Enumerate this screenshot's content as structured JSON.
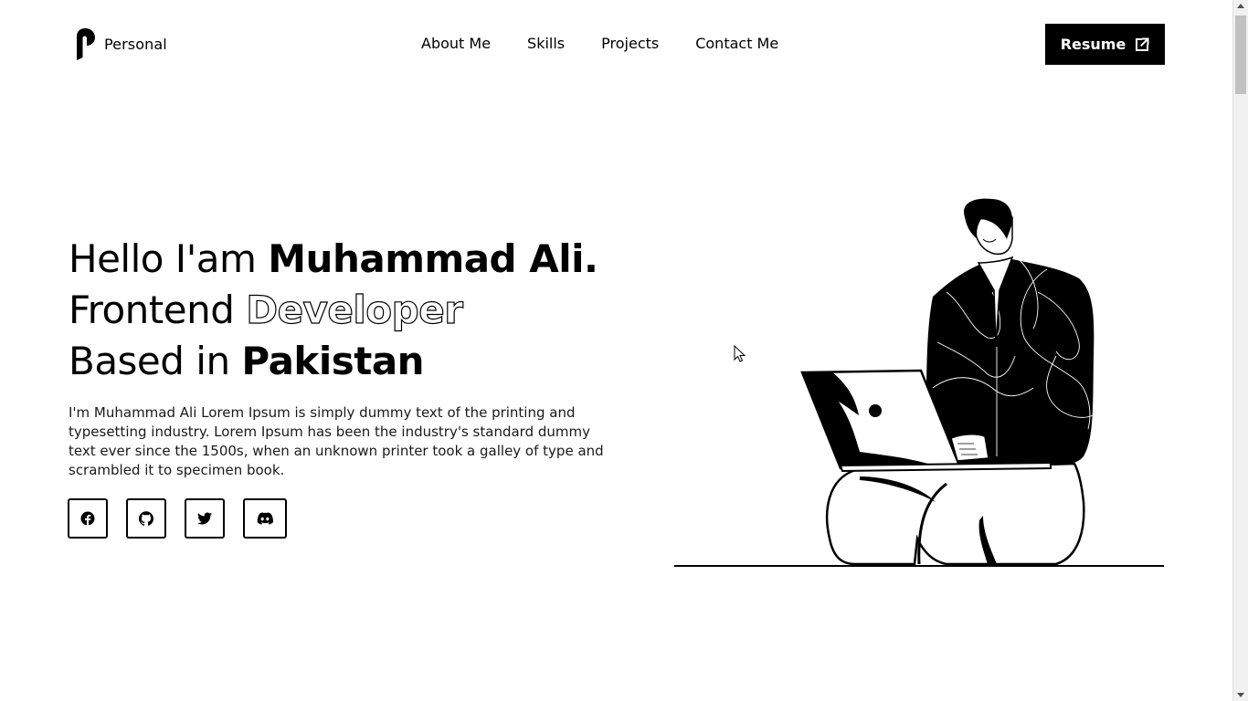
{
  "header": {
    "logo_text": "Personal",
    "nav": [
      {
        "label": "About Me"
      },
      {
        "label": "Skills"
      },
      {
        "label": "Projects"
      },
      {
        "label": "Contact Me"
      }
    ],
    "resume_label": "Resume",
    "resume_icon": "external-link-icon"
  },
  "hero": {
    "line1_prefix": "Hello I'am ",
    "line1_name": "Muhammad Ali.",
    "line2_prefix": "Frontend ",
    "line2_outlined": "Developer",
    "line3_prefix": "Based in ",
    "line3_place": "Pakistan",
    "description": "I'm Muhammad Ali Lorem Ipsum is simply dummy text of the printing and typesetting industry. Lorem Ipsum has been the industry's standard dummy text ever since the 1500s, when an unknown printer took a galley of type and scrambled it to specimen book."
  },
  "socials": [
    {
      "icon": "facebook-icon"
    },
    {
      "icon": "github-icon"
    },
    {
      "icon": "twitter-icon"
    },
    {
      "icon": "discord-icon"
    }
  ],
  "colors": {
    "background": "#ffffff",
    "text": "#000000",
    "button_bg": "#000000",
    "button_text": "#ffffff"
  }
}
